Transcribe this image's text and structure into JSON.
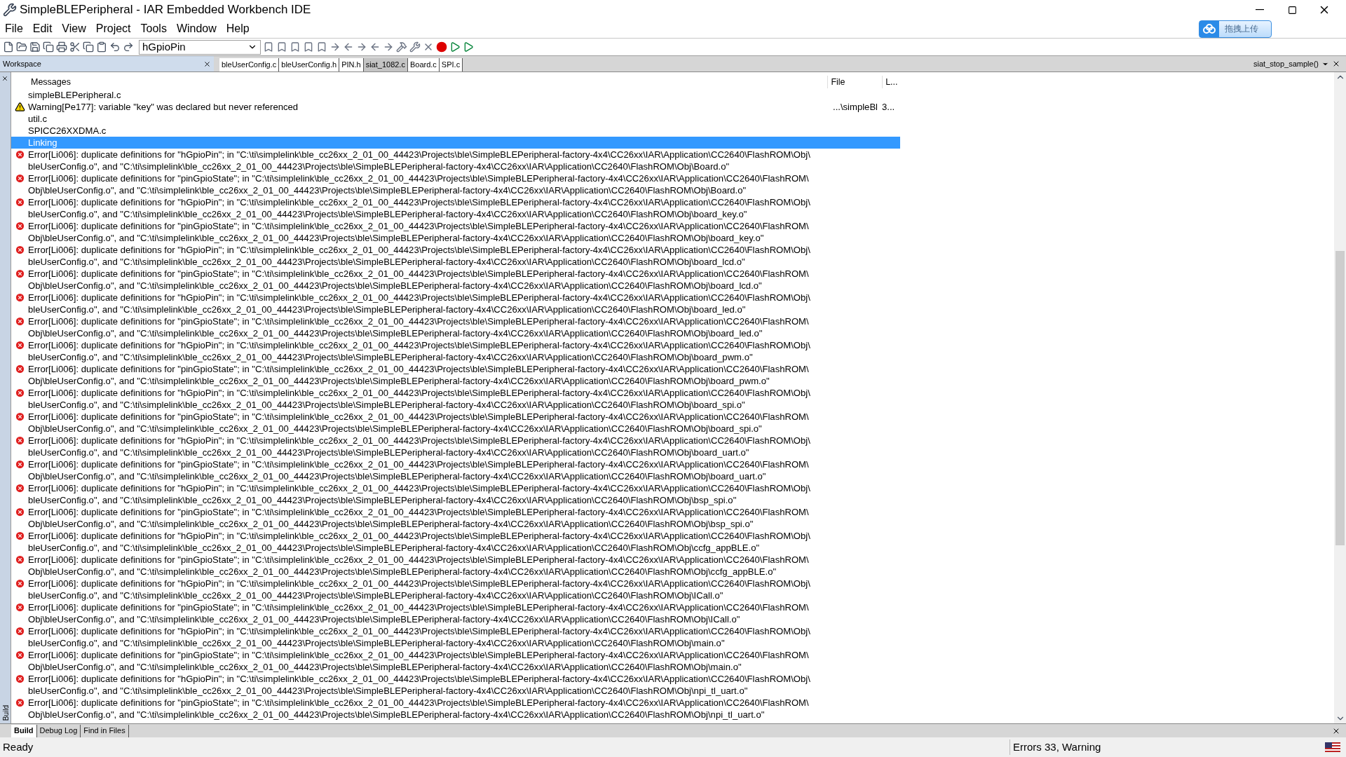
{
  "window": {
    "title": "SimpleBLEPeripheral - IAR Embedded Workbench IDE"
  },
  "upload_button": "拖拽上传",
  "menu": [
    "File",
    "Edit",
    "View",
    "Project",
    "Tools",
    "Window",
    "Help"
  ],
  "toolbar": {
    "combo_value": "hGpioPin"
  },
  "workspace": {
    "title": "Workspace"
  },
  "editor_tabs": [
    {
      "label": "bleUserConfig.c",
      "selected": false
    },
    {
      "label": "bleUserConfig.h",
      "selected": false
    },
    {
      "label": "PIN.h",
      "selected": false
    },
    {
      "label": "siat_1082.c",
      "selected": true
    },
    {
      "label": "Board.c",
      "selected": false
    },
    {
      "label": "SPI.c",
      "selected": false
    }
  ],
  "function_combo": "siat_stop_sample()",
  "messages": {
    "columns": [
      "Messages",
      "File",
      "L..."
    ],
    "rows": [
      {
        "kind": "file",
        "lines": [
          "simpleBLEPeripheral.c"
        ],
        "selected": false
      },
      {
        "kind": "warning",
        "lines": [
          "Warning[Pe177]: variable \"key\" was declared but never referenced"
        ],
        "file": "...\\simpleBl",
        "line": "3...",
        "selected": false
      },
      {
        "kind": "file",
        "lines": [
          "util.c"
        ],
        "selected": false
      },
      {
        "kind": "file",
        "lines": [
          "SPICC26XXDMA.c"
        ],
        "selected": false
      },
      {
        "kind": "file",
        "lines": [
          "Linking"
        ],
        "selected": true
      },
      {
        "kind": "error",
        "lines": [
          "Error[Li006]: duplicate definitions for \"hGpioPin\"; in \"C:\\ti\\simplelink\\ble_cc26xx_2_01_00_44423\\Projects\\ble\\SimpleBLEPeripheral-factory-4x4\\CC26xx\\IAR\\Application\\CC2640\\FlashROM\\Obj\\",
          "bleUserConfig.o\", and \"C:\\ti\\simplelink\\ble_cc26xx_2_01_00_44423\\Projects\\ble\\SimpleBLEPeripheral-factory-4x4\\CC26xx\\IAR\\Application\\CC2640\\FlashROM\\Obj\\Board.o\""
        ],
        "selected": false
      },
      {
        "kind": "error",
        "lines": [
          "Error[Li006]: duplicate definitions for \"pinGpioState\"; in \"C:\\ti\\simplelink\\ble_cc26xx_2_01_00_44423\\Projects\\ble\\SimpleBLEPeripheral-factory-4x4\\CC26xx\\IAR\\Application\\CC2640\\FlashROM\\",
          "Obj\\bleUserConfig.o\", and \"C:\\ti\\simplelink\\ble_cc26xx_2_01_00_44423\\Projects\\ble\\SimpleBLEPeripheral-factory-4x4\\CC26xx\\IAR\\Application\\CC2640\\FlashROM\\Obj\\Board.o\""
        ],
        "selected": false
      },
      {
        "kind": "error",
        "lines": [
          "Error[Li006]: duplicate definitions for \"hGpioPin\"; in \"C:\\ti\\simplelink\\ble_cc26xx_2_01_00_44423\\Projects\\ble\\SimpleBLEPeripheral-factory-4x4\\CC26xx\\IAR\\Application\\CC2640\\FlashROM\\Obj\\",
          "bleUserConfig.o\", and \"C:\\ti\\simplelink\\ble_cc26xx_2_01_00_44423\\Projects\\ble\\SimpleBLEPeripheral-factory-4x4\\CC26xx\\IAR\\Application\\CC2640\\FlashROM\\Obj\\board_key.o\""
        ],
        "selected": false
      },
      {
        "kind": "error",
        "lines": [
          "Error[Li006]: duplicate definitions for \"pinGpioState\"; in \"C:\\ti\\simplelink\\ble_cc26xx_2_01_00_44423\\Projects\\ble\\SimpleBLEPeripheral-factory-4x4\\CC26xx\\IAR\\Application\\CC2640\\FlashROM\\",
          "Obj\\bleUserConfig.o\", and \"C:\\ti\\simplelink\\ble_cc26xx_2_01_00_44423\\Projects\\ble\\SimpleBLEPeripheral-factory-4x4\\CC26xx\\IAR\\Application\\CC2640\\FlashROM\\Obj\\board_key.o\""
        ],
        "selected": false
      },
      {
        "kind": "error",
        "lines": [
          "Error[Li006]: duplicate definitions for \"hGpioPin\"; in \"C:\\ti\\simplelink\\ble_cc26xx_2_01_00_44423\\Projects\\ble\\SimpleBLEPeripheral-factory-4x4\\CC26xx\\IAR\\Application\\CC2640\\FlashROM\\Obj\\",
          "bleUserConfig.o\", and \"C:\\ti\\simplelink\\ble_cc26xx_2_01_00_44423\\Projects\\ble\\SimpleBLEPeripheral-factory-4x4\\CC26xx\\IAR\\Application\\CC2640\\FlashROM\\Obj\\board_lcd.o\""
        ],
        "selected": false
      },
      {
        "kind": "error",
        "lines": [
          "Error[Li006]: duplicate definitions for \"pinGpioState\"; in \"C:\\ti\\simplelink\\ble_cc26xx_2_01_00_44423\\Projects\\ble\\SimpleBLEPeripheral-factory-4x4\\CC26xx\\IAR\\Application\\CC2640\\FlashROM\\",
          "Obj\\bleUserConfig.o\", and \"C:\\ti\\simplelink\\ble_cc26xx_2_01_00_44423\\Projects\\ble\\SimpleBLEPeripheral-factory-4x4\\CC26xx\\IAR\\Application\\CC2640\\FlashROM\\Obj\\board_lcd.o\""
        ],
        "selected": false
      },
      {
        "kind": "error",
        "lines": [
          "Error[Li006]: duplicate definitions for \"hGpioPin\"; in \"C:\\ti\\simplelink\\ble_cc26xx_2_01_00_44423\\Projects\\ble\\SimpleBLEPeripheral-factory-4x4\\CC26xx\\IAR\\Application\\CC2640\\FlashROM\\Obj\\",
          "bleUserConfig.o\", and \"C:\\ti\\simplelink\\ble_cc26xx_2_01_00_44423\\Projects\\ble\\SimpleBLEPeripheral-factory-4x4\\CC26xx\\IAR\\Application\\CC2640\\FlashROM\\Obj\\board_led.o\""
        ],
        "selected": false
      },
      {
        "kind": "error",
        "lines": [
          "Error[Li006]: duplicate definitions for \"pinGpioState\"; in \"C:\\ti\\simplelink\\ble_cc26xx_2_01_00_44423\\Projects\\ble\\SimpleBLEPeripheral-factory-4x4\\CC26xx\\IAR\\Application\\CC2640\\FlashROM\\",
          "Obj\\bleUserConfig.o\", and \"C:\\ti\\simplelink\\ble_cc26xx_2_01_00_44423\\Projects\\ble\\SimpleBLEPeripheral-factory-4x4\\CC26xx\\IAR\\Application\\CC2640\\FlashROM\\Obj\\board_led.o\""
        ],
        "selected": false
      },
      {
        "kind": "error",
        "lines": [
          "Error[Li006]: duplicate definitions for \"hGpioPin\"; in \"C:\\ti\\simplelink\\ble_cc26xx_2_01_00_44423\\Projects\\ble\\SimpleBLEPeripheral-factory-4x4\\CC26xx\\IAR\\Application\\CC2640\\FlashROM\\Obj\\",
          "bleUserConfig.o\", and \"C:\\ti\\simplelink\\ble_cc26xx_2_01_00_44423\\Projects\\ble\\SimpleBLEPeripheral-factory-4x4\\CC26xx\\IAR\\Application\\CC2640\\FlashROM\\Obj\\board_pwm.o\""
        ],
        "selected": false
      },
      {
        "kind": "error",
        "lines": [
          "Error[Li006]: duplicate definitions for \"pinGpioState\"; in \"C:\\ti\\simplelink\\ble_cc26xx_2_01_00_44423\\Projects\\ble\\SimpleBLEPeripheral-factory-4x4\\CC26xx\\IAR\\Application\\CC2640\\FlashROM\\",
          "Obj\\bleUserConfig.o\", and \"C:\\ti\\simplelink\\ble_cc26xx_2_01_00_44423\\Projects\\ble\\SimpleBLEPeripheral-factory-4x4\\CC26xx\\IAR\\Application\\CC2640\\FlashROM\\Obj\\board_pwm.o\""
        ],
        "selected": false
      },
      {
        "kind": "error",
        "lines": [
          "Error[Li006]: duplicate definitions for \"hGpioPin\"; in \"C:\\ti\\simplelink\\ble_cc26xx_2_01_00_44423\\Projects\\ble\\SimpleBLEPeripheral-factory-4x4\\CC26xx\\IAR\\Application\\CC2640\\FlashROM\\Obj\\",
          "bleUserConfig.o\", and \"C:\\ti\\simplelink\\ble_cc26xx_2_01_00_44423\\Projects\\ble\\SimpleBLEPeripheral-factory-4x4\\CC26xx\\IAR\\Application\\CC2640\\FlashROM\\Obj\\board_spi.o\""
        ],
        "selected": false
      },
      {
        "kind": "error",
        "lines": [
          "Error[Li006]: duplicate definitions for \"pinGpioState\"; in \"C:\\ti\\simplelink\\ble_cc26xx_2_01_00_44423\\Projects\\ble\\SimpleBLEPeripheral-factory-4x4\\CC26xx\\IAR\\Application\\CC2640\\FlashROM\\",
          "Obj\\bleUserConfig.o\", and \"C:\\ti\\simplelink\\ble_cc26xx_2_01_00_44423\\Projects\\ble\\SimpleBLEPeripheral-factory-4x4\\CC26xx\\IAR\\Application\\CC2640\\FlashROM\\Obj\\board_spi.o\""
        ],
        "selected": false
      },
      {
        "kind": "error",
        "lines": [
          "Error[Li006]: duplicate definitions for \"hGpioPin\"; in \"C:\\ti\\simplelink\\ble_cc26xx_2_01_00_44423\\Projects\\ble\\SimpleBLEPeripheral-factory-4x4\\CC26xx\\IAR\\Application\\CC2640\\FlashROM\\Obj\\",
          "bleUserConfig.o\", and \"C:\\ti\\simplelink\\ble_cc26xx_2_01_00_44423\\Projects\\ble\\SimpleBLEPeripheral-factory-4x4\\CC26xx\\IAR\\Application\\CC2640\\FlashROM\\Obj\\board_uart.o\""
        ],
        "selected": false
      },
      {
        "kind": "error",
        "lines": [
          "Error[Li006]: duplicate definitions for \"pinGpioState\"; in \"C:\\ti\\simplelink\\ble_cc26xx_2_01_00_44423\\Projects\\ble\\SimpleBLEPeripheral-factory-4x4\\CC26xx\\IAR\\Application\\CC2640\\FlashROM\\",
          "Obj\\bleUserConfig.o\", and \"C:\\ti\\simplelink\\ble_cc26xx_2_01_00_44423\\Projects\\ble\\SimpleBLEPeripheral-factory-4x4\\CC26xx\\IAR\\Application\\CC2640\\FlashROM\\Obj\\board_uart.o\""
        ],
        "selected": false
      },
      {
        "kind": "error",
        "lines": [
          "Error[Li006]: duplicate definitions for \"hGpioPin\"; in \"C:\\ti\\simplelink\\ble_cc26xx_2_01_00_44423\\Projects\\ble\\SimpleBLEPeripheral-factory-4x4\\CC26xx\\IAR\\Application\\CC2640\\FlashROM\\Obj\\",
          "bleUserConfig.o\", and \"C:\\ti\\simplelink\\ble_cc26xx_2_01_00_44423\\Projects\\ble\\SimpleBLEPeripheral-factory-4x4\\CC26xx\\IAR\\Application\\CC2640\\FlashROM\\Obj\\bsp_spi.o\""
        ],
        "selected": false
      },
      {
        "kind": "error",
        "lines": [
          "Error[Li006]: duplicate definitions for \"pinGpioState\"; in \"C:\\ti\\simplelink\\ble_cc26xx_2_01_00_44423\\Projects\\ble\\SimpleBLEPeripheral-factory-4x4\\CC26xx\\IAR\\Application\\CC2640\\FlashROM\\",
          "Obj\\bleUserConfig.o\", and \"C:\\ti\\simplelink\\ble_cc26xx_2_01_00_44423\\Projects\\ble\\SimpleBLEPeripheral-factory-4x4\\CC26xx\\IAR\\Application\\CC2640\\FlashROM\\Obj\\bsp_spi.o\""
        ],
        "selected": false
      },
      {
        "kind": "error",
        "lines": [
          "Error[Li006]: duplicate definitions for \"hGpioPin\"; in \"C:\\ti\\simplelink\\ble_cc26xx_2_01_00_44423\\Projects\\ble\\SimpleBLEPeripheral-factory-4x4\\CC26xx\\IAR\\Application\\CC2640\\FlashROM\\Obj\\",
          "bleUserConfig.o\", and \"C:\\ti\\simplelink\\ble_cc26xx_2_01_00_44423\\Projects\\ble\\SimpleBLEPeripheral-factory-4x4\\CC26xx\\IAR\\Application\\CC2640\\FlashROM\\Obj\\ccfg_appBLE.o\""
        ],
        "selected": false
      },
      {
        "kind": "error",
        "lines": [
          "Error[Li006]: duplicate definitions for \"pinGpioState\"; in \"C:\\ti\\simplelink\\ble_cc26xx_2_01_00_44423\\Projects\\ble\\SimpleBLEPeripheral-factory-4x4\\CC26xx\\IAR\\Application\\CC2640\\FlashROM\\",
          "Obj\\bleUserConfig.o\", and \"C:\\ti\\simplelink\\ble_cc26xx_2_01_00_44423\\Projects\\ble\\SimpleBLEPeripheral-factory-4x4\\CC26xx\\IAR\\Application\\CC2640\\FlashROM\\Obj\\ccfg_appBLE.o\""
        ],
        "selected": false
      },
      {
        "kind": "error",
        "lines": [
          "Error[Li006]: duplicate definitions for \"hGpioPin\"; in \"C:\\ti\\simplelink\\ble_cc26xx_2_01_00_44423\\Projects\\ble\\SimpleBLEPeripheral-factory-4x4\\CC26xx\\IAR\\Application\\CC2640\\FlashROM\\Obj\\",
          "bleUserConfig.o\", and \"C:\\ti\\simplelink\\ble_cc26xx_2_01_00_44423\\Projects\\ble\\SimpleBLEPeripheral-factory-4x4\\CC26xx\\IAR\\Application\\CC2640\\FlashROM\\Obj\\ICall.o\""
        ],
        "selected": false
      },
      {
        "kind": "error",
        "lines": [
          "Error[Li006]: duplicate definitions for \"pinGpioState\"; in \"C:\\ti\\simplelink\\ble_cc26xx_2_01_00_44423\\Projects\\ble\\SimpleBLEPeripheral-factory-4x4\\CC26xx\\IAR\\Application\\CC2640\\FlashROM\\",
          "Obj\\bleUserConfig.o\", and \"C:\\ti\\simplelink\\ble_cc26xx_2_01_00_44423\\Projects\\ble\\SimpleBLEPeripheral-factory-4x4\\CC26xx\\IAR\\Application\\CC2640\\FlashROM\\Obj\\ICall.o\""
        ],
        "selected": false
      },
      {
        "kind": "error",
        "lines": [
          "Error[Li006]: duplicate definitions for \"hGpioPin\"; in \"C:\\ti\\simplelink\\ble_cc26xx_2_01_00_44423\\Projects\\ble\\SimpleBLEPeripheral-factory-4x4\\CC26xx\\IAR\\Application\\CC2640\\FlashROM\\Obj\\",
          "bleUserConfig.o\", and \"C:\\ti\\simplelink\\ble_cc26xx_2_01_00_44423\\Projects\\ble\\SimpleBLEPeripheral-factory-4x4\\CC26xx\\IAR\\Application\\CC2640\\FlashROM\\Obj\\main.o\""
        ],
        "selected": false
      },
      {
        "kind": "error",
        "lines": [
          "Error[Li006]: duplicate definitions for \"pinGpioState\"; in \"C:\\ti\\simplelink\\ble_cc26xx_2_01_00_44423\\Projects\\ble\\SimpleBLEPeripheral-factory-4x4\\CC26xx\\IAR\\Application\\CC2640\\FlashROM\\",
          "Obj\\bleUserConfig.o\", and \"C:\\ti\\simplelink\\ble_cc26xx_2_01_00_44423\\Projects\\ble\\SimpleBLEPeripheral-factory-4x4\\CC26xx\\IAR\\Application\\CC2640\\FlashROM\\Obj\\main.o\""
        ],
        "selected": false
      },
      {
        "kind": "error",
        "lines": [
          "Error[Li006]: duplicate definitions for \"hGpioPin\"; in \"C:\\ti\\simplelink\\ble_cc26xx_2_01_00_44423\\Projects\\ble\\SimpleBLEPeripheral-factory-4x4\\CC26xx\\IAR\\Application\\CC2640\\FlashROM\\Obj\\",
          "bleUserConfig.o\", and \"C:\\ti\\simplelink\\ble_cc26xx_2_01_00_44423\\Projects\\ble\\SimpleBLEPeripheral-factory-4x4\\CC26xx\\IAR\\Application\\CC2640\\FlashROM\\Obj\\npi_tl_uart.o\""
        ],
        "selected": false
      },
      {
        "kind": "error",
        "lines": [
          "Error[Li006]: duplicate definitions for \"pinGpioState\"; in \"C:\\ti\\simplelink\\ble_cc26xx_2_01_00_44423\\Projects\\ble\\SimpleBLEPeripheral-factory-4x4\\CC26xx\\IAR\\Application\\CC2640\\FlashROM\\",
          "Obj\\bleUserConfig.o\", and \"C:\\ti\\simplelink\\ble_cc26xx_2_01_00_44423\\Projects\\ble\\SimpleBLEPeripheral-factory-4x4\\CC26xx\\IAR\\Application\\CC2640\\FlashROM\\Obj\\npi_tl_uart.o\""
        ],
        "selected": false
      }
    ]
  },
  "side_label": "Build",
  "output_tabs": [
    {
      "label": "Build",
      "selected": true
    },
    {
      "label": "Debug Log",
      "selected": false
    },
    {
      "label": "Find in Files",
      "selected": false
    }
  ],
  "status_bar": {
    "left": "Ready",
    "right": "Errors 33, Warning"
  }
}
